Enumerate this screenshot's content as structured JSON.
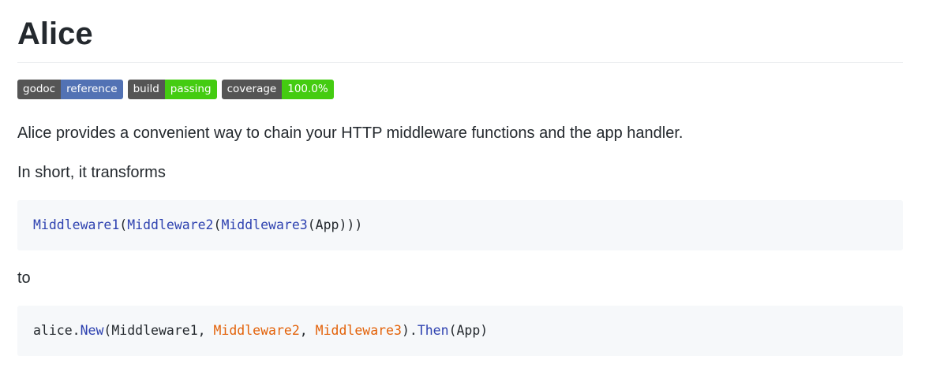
{
  "title": "Alice",
  "badges": [
    {
      "label": "godoc",
      "value": "reference",
      "color": "#5272b4"
    },
    {
      "label": "build",
      "value": "passing",
      "color": "#44cc11"
    },
    {
      "label": "coverage",
      "value": "100.0%",
      "color": "#44cc11"
    }
  ],
  "paragraphs": {
    "intro": "Alice provides a convenient way to chain your HTTP middleware functions and the app handler.",
    "short": "In short, it transforms",
    "to": "to"
  },
  "code1": {
    "t1": "Middleware1",
    "t2": "(",
    "t3": "Middleware2",
    "t4": "(",
    "t5": "Middleware3",
    "t6": "(App)))"
  },
  "code2": {
    "t1": "alice.",
    "t2": "New",
    "t3": "(Middleware1, ",
    "t4": "Middleware2",
    "t5": ", ",
    "t6": "Middleware3",
    "t7": ").",
    "t8": "Then",
    "t9": "(App)"
  },
  "colors": {
    "code_function": "#2e42b0",
    "code_highlight": "#e36209",
    "code_background": "#f6f8fa",
    "text": "#24292e"
  }
}
